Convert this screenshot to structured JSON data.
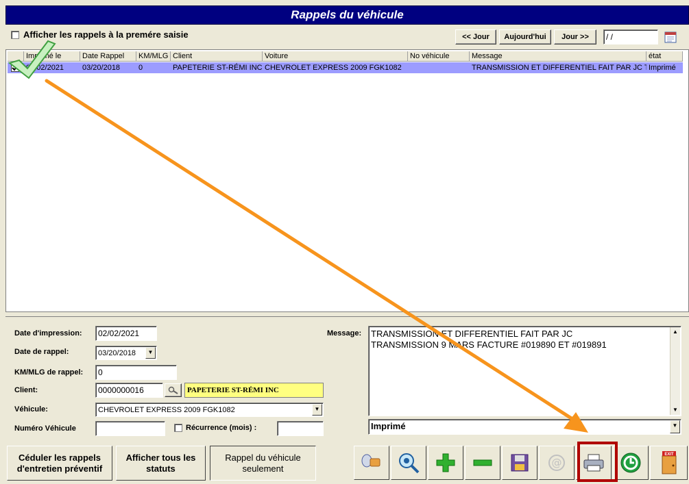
{
  "window": {
    "title": "Rappels du véhicule"
  },
  "filter": {
    "show_first_entry_label": "Afficher les rappels à  la premére saisie",
    "show_first_entry_checked": false
  },
  "datenav": {
    "prev_label": "<< Jour",
    "today_label": "Aujourd'hui",
    "next_label": "Jour >>",
    "date_value": " / /"
  },
  "grid": {
    "columns": [
      "Imprimé le",
      "Date Rappel",
      "KM/MLG",
      "Client",
      "Voiture",
      "No véhicule",
      "Message",
      "état"
    ],
    "rows": [
      {
        "checked": true,
        "printed_on": "02/02/2021",
        "reminder_date": "03/20/2018",
        "km": "0",
        "client": "PAPETERIE ST-RÉMI INC",
        "car": "CHEVROLET EXPRESS 2009 FGK1082",
        "vehicle_no": "",
        "message": "TRANSMISSION ET DIFFERENTIEL FAIT PAR JC T",
        "status": "Imprimé"
      }
    ]
  },
  "form": {
    "print_date_label": "Date d'impression:",
    "print_date_value": "02/02/2021",
    "reminder_date_label": "Date de rappel:",
    "reminder_date_value": "03/20/2018",
    "km_label": "KM/MLG de rappel:",
    "km_value": "0",
    "client_label": "Client:",
    "client_code": "0000000016",
    "client_name": "PAPETERIE ST-RÉMI INC",
    "vehicle_label": "Véhicule:",
    "vehicle_value": "CHEVROLET EXPRESS 2009 FGK1082",
    "vehicle_no_label": "Numéro Véhicule",
    "vehicle_no_value": "",
    "recurrence_label": "Récurrence (mois) :",
    "recurrence_value": "",
    "message_label": "Message:",
    "message_line1": "TRANSMISSION ET DIFFERENTIEL FAIT PAR JC",
    "message_line2": "TRANSMISSION 9 MARS   FACTURE #019890 ET #019891",
    "status_value": "Imprimé"
  },
  "bottom": {
    "schedule_label": "Céduler les rappels\nd'entretien préventif",
    "show_all_label": "Afficher tous les\nstatuts",
    "vehicle_only_label": "Rappel du véhicule\nseulement",
    "exit_badge": "EXIT"
  },
  "colors": {
    "title_bar": "#000080",
    "selected_row": "#9c9cff",
    "client_name_bg": "#ffff80",
    "highlight_box": "#b00000",
    "arrow": "#f7941d"
  }
}
